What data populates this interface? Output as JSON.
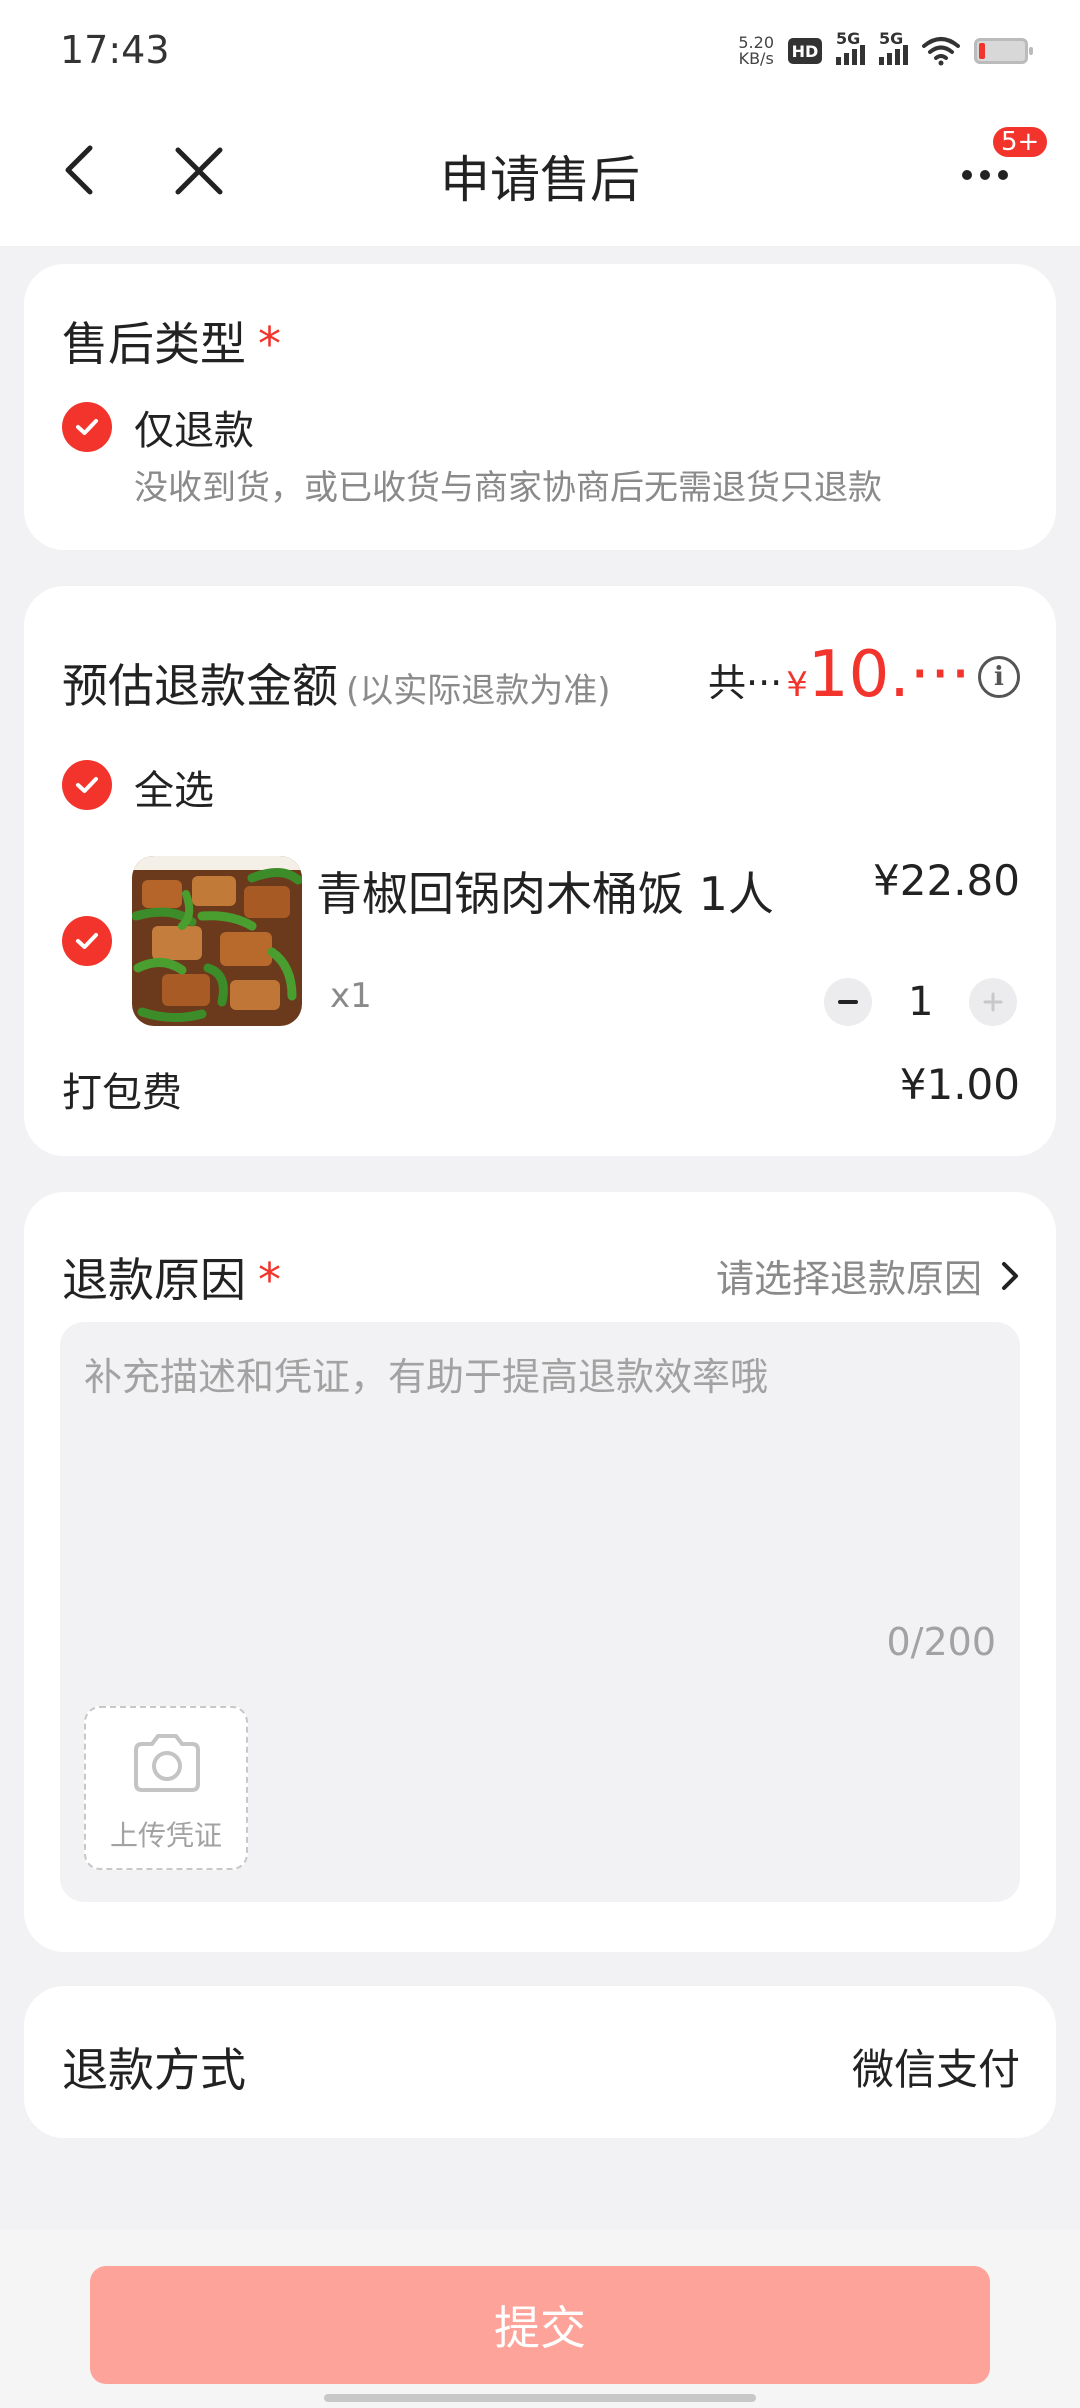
{
  "status_bar": {
    "time": "17:43",
    "net_speed_value": "5.20",
    "net_speed_unit": "KB/s",
    "hd_label": "HD",
    "network_1": "5G",
    "network_2": "5G"
  },
  "nav": {
    "title": "申请售后",
    "badge": "5+"
  },
  "after_sale_type": {
    "title": "售后类型",
    "required_mark": "*",
    "option_label": "仅退款",
    "option_desc": "没收到货，或已收货与商家协商后无需退货只退款"
  },
  "refund_amount": {
    "title": "预估退款金额",
    "subtitle": "(以实际退款为准)",
    "total_label": "共···",
    "currency": "¥",
    "total_value": "10.···",
    "select_all_label": "全选",
    "item": {
      "name": "青椒回锅肉木桶饭 1人",
      "price": "¥22.80",
      "qty_label": "x1",
      "stepper_value": "1"
    },
    "packing_label": "打包费",
    "packing_price": "¥1.00"
  },
  "refund_reason": {
    "title": "退款原因",
    "required_mark": "*",
    "select_placeholder": "请选择退款原因",
    "desc_placeholder": "补充描述和凭证，有助于提高退款效率哦",
    "char_count": "0/200",
    "upload_label": "上传凭证"
  },
  "refund_method": {
    "label": "退款方式",
    "value": "微信支付"
  },
  "submit_label": "提交",
  "colors": {
    "accent": "#f2342c",
    "submit_disabled": "#fda39a",
    "page_bg": "#f2f2f4"
  }
}
